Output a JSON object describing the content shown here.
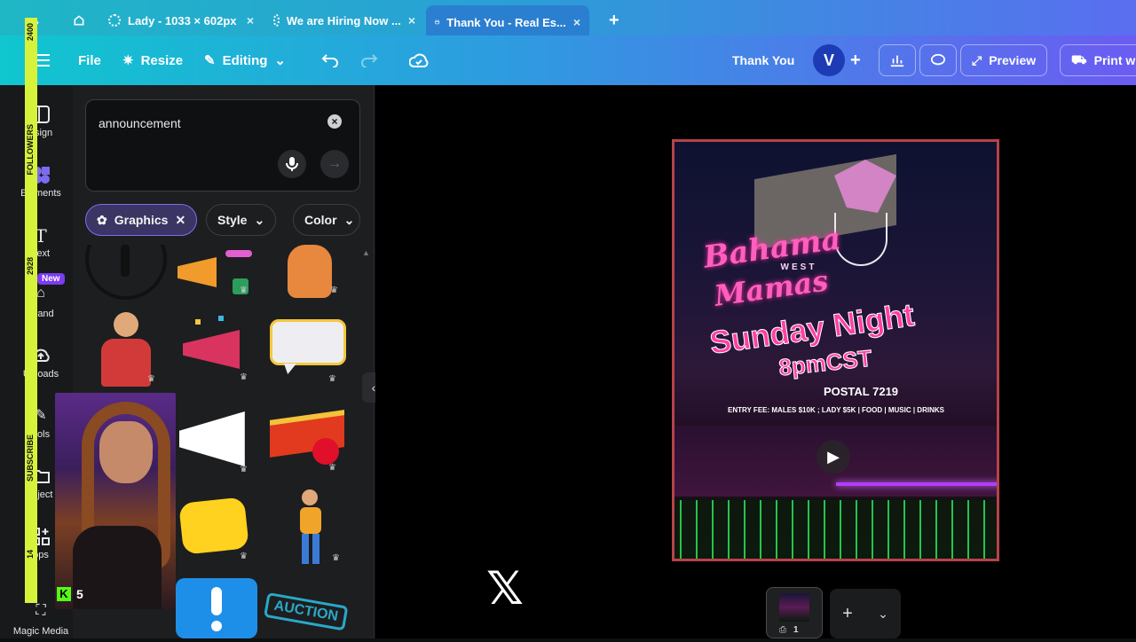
{
  "tabs": [
    {
      "label": "Lady - 1033 × 602px",
      "close": "×"
    },
    {
      "label": "We are Hiring Now ...",
      "close": "×"
    },
    {
      "label": "Thank You - Real Es...",
      "close": "×"
    }
  ],
  "new_tab": "+",
  "toolbar": {
    "file": "File",
    "resize": "Resize",
    "editing": "Editing",
    "doc_title": "Thank You",
    "avatar_initial": "V",
    "add": "+",
    "preview": "Preview",
    "print": "Print wi"
  },
  "rail": {
    "design": "esign",
    "elements": "Elements",
    "text": "Text",
    "brand": "Brand",
    "new_badge": "New",
    "uploads": "Uploads",
    "tools": "ools",
    "projects": "roject",
    "apps": "pps",
    "magic": "Magic Media"
  },
  "overlay": {
    "num1": "2400",
    "followers": "FOLLOWERS",
    "num2": "2928",
    "subscribe": "SUBSCRIBE",
    "num3": "14",
    "kick_count": "5"
  },
  "search": {
    "query": "announcement"
  },
  "chips": {
    "graphics": "Graphics",
    "style": "Style",
    "color": "Color"
  },
  "grid": {
    "auction": "AUCTION"
  },
  "poster": {
    "brand1": "Bahama",
    "brand_mid": "WEST",
    "brand2": "Mamas",
    "headline": "Sunday Night",
    "time": "8pmCST",
    "location": "POSTAL 7219",
    "entry": "ENTRY FEE: MALES $10K ; LADY $5K | FOOD | MUSIC | DRINKS"
  },
  "pages": {
    "count": "1"
  },
  "colors": {
    "accent": "#7c6cf1",
    "poster_border": "#b6434a",
    "neon_pink": "#ff3fa4"
  }
}
